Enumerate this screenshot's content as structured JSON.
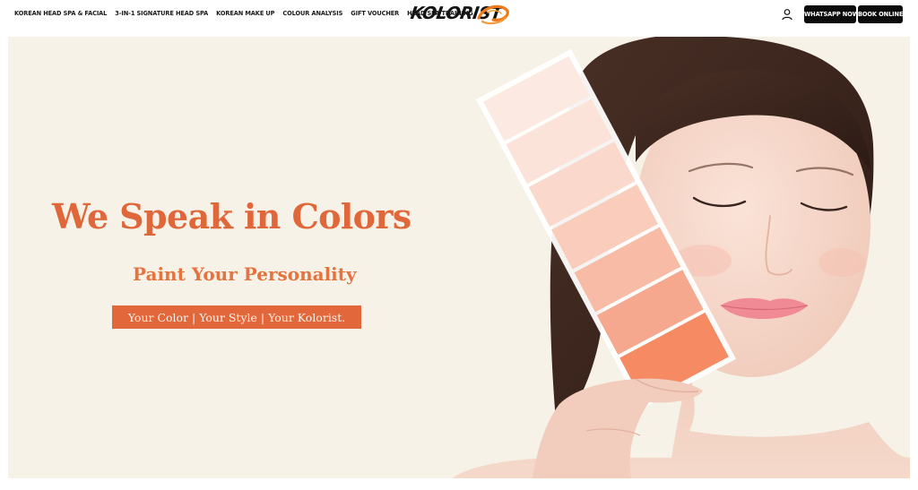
{
  "header": {
    "nav": [
      "KOREAN HEAD SPA & FACIAL",
      "3-IN-1 SIGNATURE HEAD SPA",
      "KOREAN MAKE UP",
      "COLOUR ANALYSIS",
      "GIFT VOUCHER",
      "HEAD SPA TRAINING"
    ],
    "logo_text": "KOLORIST",
    "whatsapp_label": "WHATSAPP NOW",
    "book_label": "BOOK ONLINE",
    "icons": {
      "account": "user-icon"
    }
  },
  "hero": {
    "title": "We Speak in Colors",
    "subtitle": "Paint Your Personality",
    "tagline": "Your Color | Your Style | Your Kolorist."
  },
  "colors": {
    "accent": "#e0673a",
    "hero_bg": "#f7f2e8",
    "button_dark": "#0b0b0b",
    "logo_orange": "#f07a1a"
  }
}
